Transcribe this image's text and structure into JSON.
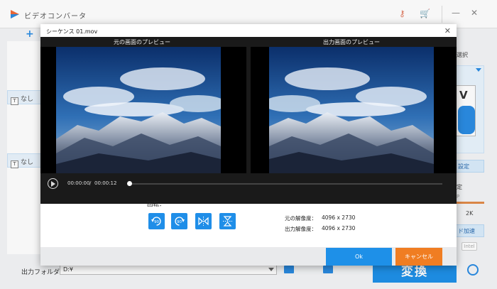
{
  "app": {
    "title": "ビデオコンバータ",
    "add_label": "+",
    "subtitle_chips": [
      "なし",
      "なし"
    ],
    "chip_icon_letter": "T",
    "right_panel": {
      "format_select_label": "選択",
      "format_letter": "V",
      "settings_label": "設定",
      "settings2_label": "定",
      "res_label": "2K",
      "accel_label": "ド加速",
      "intel_label": "Intel",
      "slider_label": "P"
    },
    "output_folder_label": "出力フォルダ：",
    "output_folder_value": "D:¥",
    "convert_label": "変換"
  },
  "dialog": {
    "title": "シーケンス 01.mov",
    "original_preview_label": "元の画面のプレビュー",
    "output_preview_label": "出力画面のプレビュー",
    "time_current": "00:00:00",
    "time_separator": "/",
    "time_total": "00:00:12",
    "progress": 0.0,
    "rotate_label": "回転：",
    "rotate_buttons": [
      {
        "name": "rotate-left-90-icon",
        "text": "90"
      },
      {
        "name": "rotate-right-90-icon",
        "text": "90"
      },
      {
        "name": "flip-horizontal-icon",
        "text": ""
      },
      {
        "name": "flip-vertical-icon",
        "text": ""
      }
    ],
    "original_resolution_label": "元の解像度：",
    "original_resolution_value": "4096 x 2730",
    "output_resolution_label": "出力解像度：",
    "output_resolution_value": "4096 x 2730",
    "ok_label": "Ok",
    "cancel_label": "キャンセル"
  },
  "colors": {
    "accent": "#1e90e8",
    "cancel": "#f07d22",
    "preview_bg": "#1a1a1a"
  }
}
